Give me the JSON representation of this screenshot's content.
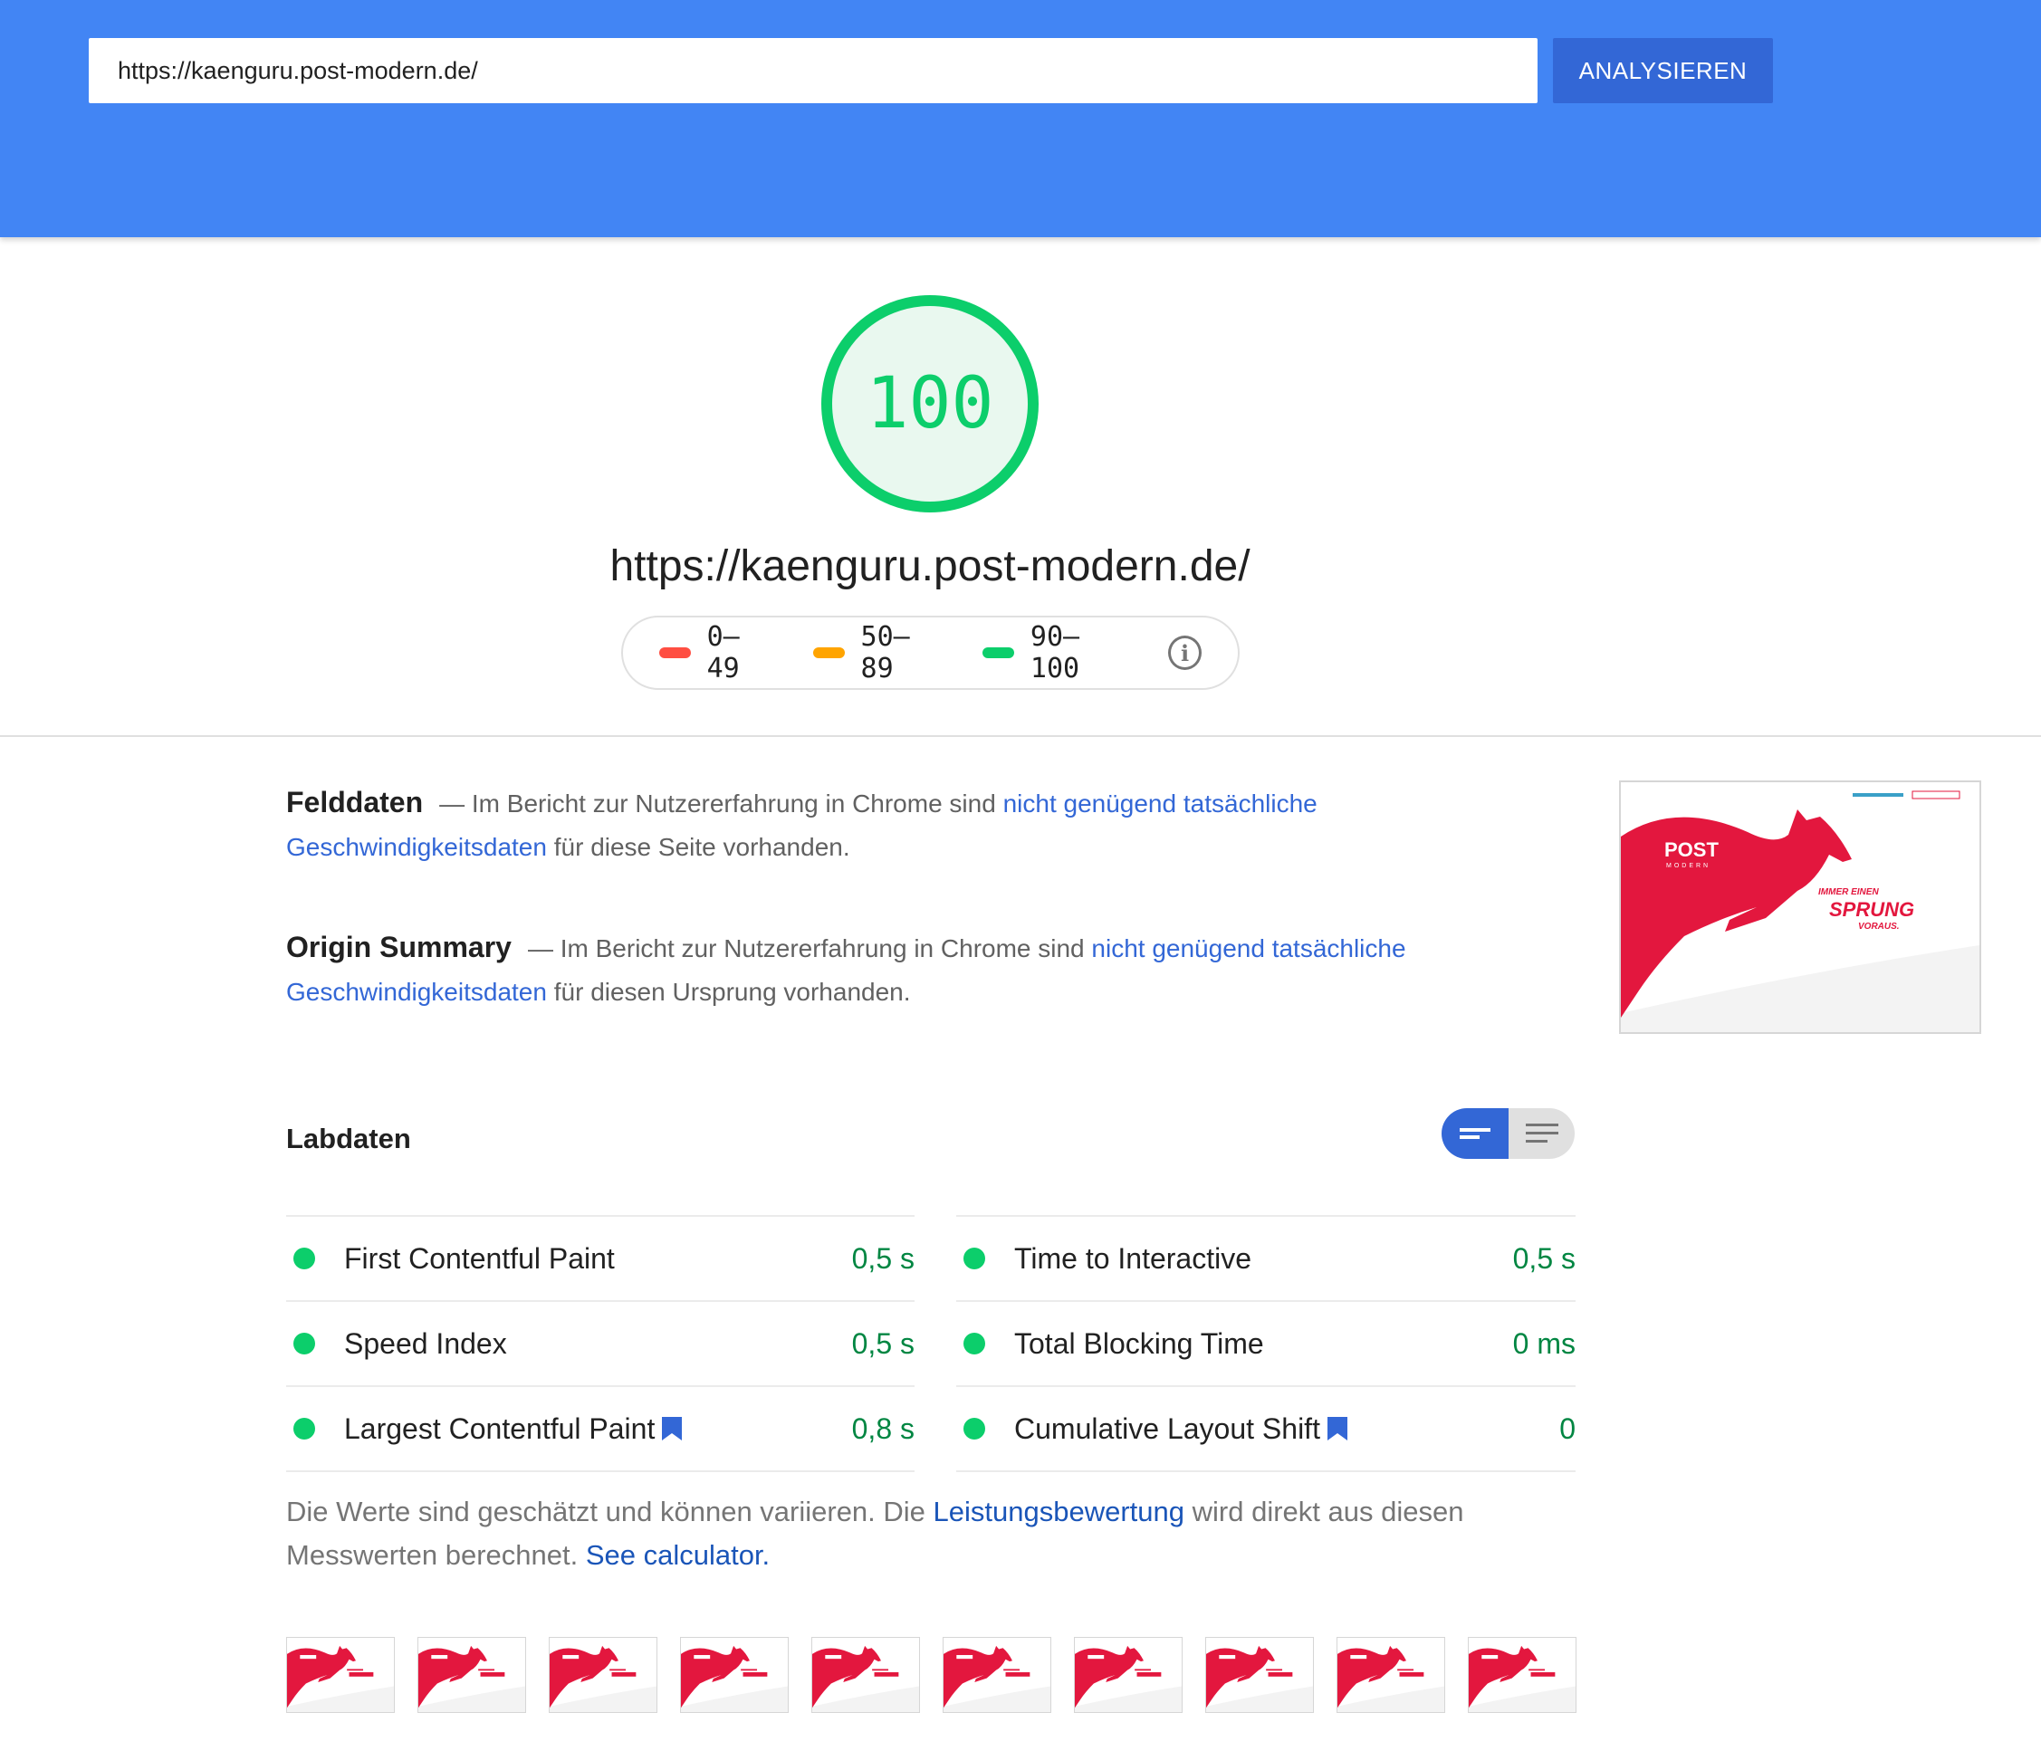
{
  "header": {
    "url_value": "https://kaenguru.post-modern.de/",
    "analyze_label": "ANALYSIEREN"
  },
  "score": {
    "value": "100",
    "url": "https://kaenguru.post-modern.de/",
    "legend": [
      {
        "label": "0–49",
        "color": "#ff4e42"
      },
      {
        "label": "50–89",
        "color": "#ffa400"
      },
      {
        "label": "90–100",
        "color": "#0cce6b"
      }
    ]
  },
  "field_data": {
    "heading": "Felddaten",
    "prefix": "— Im Bericht zur Nutzererfahrung in Chrome sind ",
    "link": "nicht genügend tatsächliche Geschwindigkeitsdaten",
    "suffix": " für diese Seite vorhanden."
  },
  "origin_summary": {
    "heading": "Origin Summary",
    "prefix": "— Im Bericht zur Nutzererfahrung in Chrome sind ",
    "link": "nicht genügend tatsächliche Geschwindigkeitsdaten",
    "suffix": " für diesen Ursprung vorhanden."
  },
  "thumbnail": {
    "logo_top": "POST",
    "logo_bottom": "MODERN",
    "tagline_top": "IMMER EINEN",
    "tagline_main": "SPRUNG",
    "tagline_bottom": "VORAUS."
  },
  "lab_data": {
    "title": "Labdaten",
    "metrics_left": [
      {
        "name": "First Contentful Paint",
        "value": "0,5 s",
        "bookmark": false
      },
      {
        "name": "Speed Index",
        "value": "0,5 s",
        "bookmark": false
      },
      {
        "name": "Largest Contentful Paint",
        "value": "0,8 s",
        "bookmark": true
      }
    ],
    "metrics_right": [
      {
        "name": "Time to Interactive",
        "value": "0,5 s",
        "bookmark": false
      },
      {
        "name": "Total Blocking Time",
        "value": "0 ms",
        "bookmark": false
      },
      {
        "name": "Cumulative Layout Shift",
        "value": "0",
        "bookmark": true
      }
    ],
    "note_prefix": "Die Werte sind geschätzt und können variieren. Die ",
    "note_link": "Leistungsbewertung",
    "note_middle": " wird direkt aus diesen Messwerten berechnet. ",
    "note_link2": "See calculator."
  },
  "colors": {
    "header_bg": "#4285f4",
    "pass_green": "#0cce6b",
    "brand_red": "#e3173e",
    "link_blue": "#3367d6"
  }
}
